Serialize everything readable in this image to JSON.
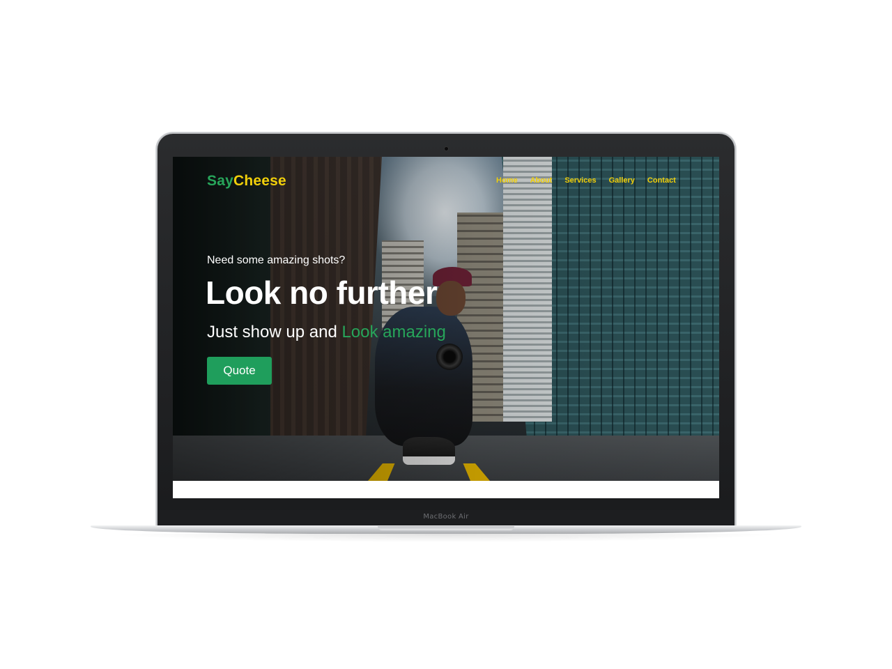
{
  "device": {
    "model_label": "MacBook Air"
  },
  "site": {
    "logo": {
      "part1": "Say",
      "part2": "Cheese"
    },
    "nav": {
      "items": [
        "Home",
        "About",
        "Services",
        "Gallery",
        "Contact"
      ]
    },
    "hero": {
      "pre_heading": "Need some amazing shots?",
      "heading": "Look no further",
      "sub_plain": "Just show up and ",
      "sub_accent": "Look amazing",
      "button_label": "Quote",
      "background_image": "photographer crouching in city street with camera"
    }
  },
  "colors": {
    "brand_green": "#27a55a",
    "brand_yellow": "#f0cf0a",
    "button_green": "#1f9e5c"
  }
}
